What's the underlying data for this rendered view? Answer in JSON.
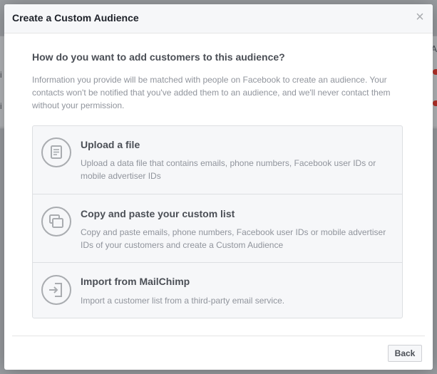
{
  "background": {
    "right_header_fragment": "A",
    "left_row_fragments": [
      "i",
      "i"
    ]
  },
  "dialog": {
    "title": "Create a Custom Audience",
    "close_glyph": "×",
    "question": "How do you want to add customers to this audience?",
    "info": "Information you provide will be matched with people on Facebook to create an audience. Your contacts won't be notified that you've added them to an audience, and we'll never contact them without your permission.",
    "options": [
      {
        "icon": "document-icon",
        "title": "Upload a file",
        "description": "Upload a data file that contains emails, phone numbers, Facebook user IDs or mobile advertiser IDs"
      },
      {
        "icon": "copy-icon",
        "title": "Copy and paste your custom list",
        "description": "Copy and paste emails, phone numbers, Facebook user IDs or mobile advertiser IDs of your customers and create a Custom Audience"
      },
      {
        "icon": "import-icon",
        "title": "Import from MailChimp",
        "description": "Import a customer list from a third-party email service."
      }
    ],
    "back_label": "Back"
  },
  "colors": {
    "header_bg": "#f6f7f9",
    "text_dark": "#4b4f56",
    "text_muted": "#90949c",
    "border": "#dddfe2",
    "icon_stroke": "#a9acb0"
  }
}
